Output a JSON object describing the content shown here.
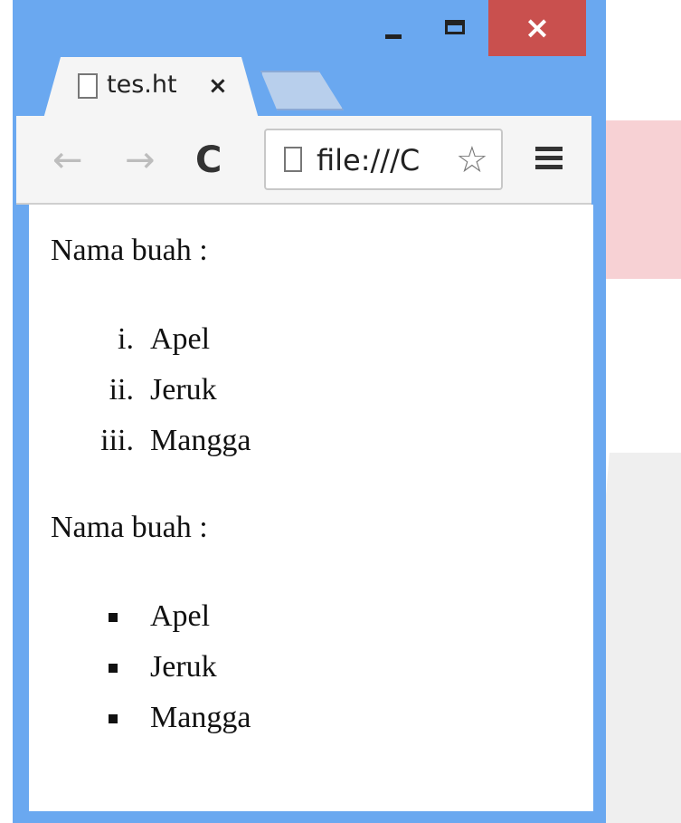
{
  "window": {
    "controls": {
      "minimize_icon": "minimize-icon",
      "maximize_icon": "maximize-icon",
      "close_glyph": "×"
    }
  },
  "tabs": [
    {
      "title": "tes.ht",
      "close_glyph": "×",
      "icon": "page-icon",
      "active": true
    }
  ],
  "toolbar": {
    "back_glyph": "←",
    "forward_glyph": "→",
    "reload_glyph": "C",
    "address": "file:///C",
    "star_glyph": "☆",
    "menu_icon": "hamburger-menu-icon"
  },
  "page": {
    "sections": [
      {
        "heading": "Nama buah :",
        "list_type": "ordered-roman",
        "items": [
          {
            "marker": "i.",
            "label": "Apel"
          },
          {
            "marker": "ii.",
            "label": "Jeruk"
          },
          {
            "marker": "iii.",
            "label": "Mangga"
          }
        ]
      },
      {
        "heading": "Nama buah :",
        "list_type": "unordered-square",
        "items": [
          {
            "label": "Apel"
          },
          {
            "label": "Jeruk"
          },
          {
            "label": "Mangga"
          }
        ]
      }
    ]
  },
  "colors": {
    "window_frame": "#6aa8f0",
    "close_button": "#c9504e",
    "toolbar": "#f5f5f5"
  }
}
